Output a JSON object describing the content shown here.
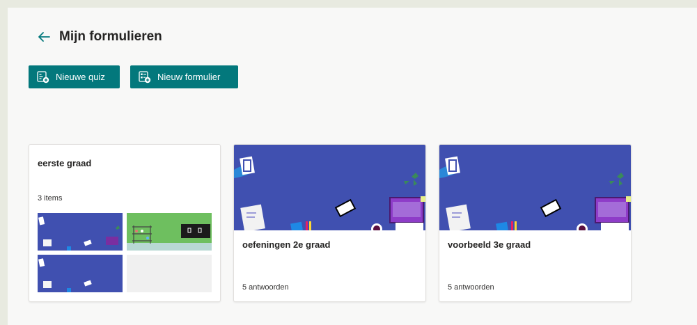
{
  "header": {
    "title": "Mijn formulieren",
    "back_icon": "arrow-left-icon"
  },
  "toolbar": {
    "new_quiz_label": "Nieuwe quiz",
    "new_quiz_icon": "quiz-add-icon",
    "new_form_label": "Nieuw formulier",
    "new_form_icon": "form-add-icon"
  },
  "collection": {
    "title": "eerste graad",
    "count": "3 items"
  },
  "forms": [
    {
      "title": "oefeningen 2e graad",
      "responses": "5 antwoorden"
    },
    {
      "title": "voorbeeld 3e graad",
      "responses": "5 antwoorden"
    }
  ],
  "colors": {
    "accent": "#03787c",
    "thumb_blue": "#4050b0",
    "thumb_green": "#6ebf5f"
  }
}
